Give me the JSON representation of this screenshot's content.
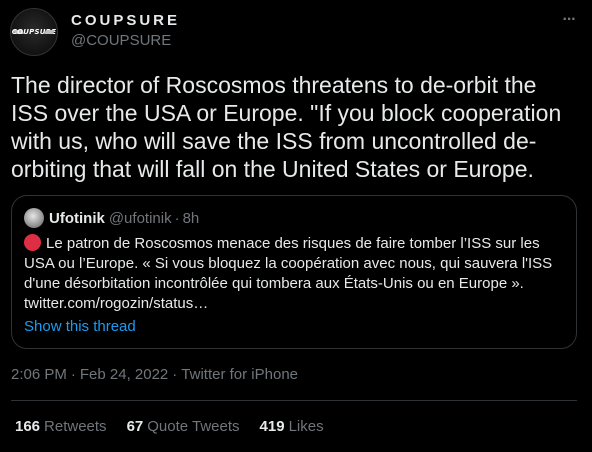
{
  "author": {
    "display_name": "COUPSURE",
    "handle": "@COUPSURE",
    "avatar_text": "COUPSURE"
  },
  "more_icon": "more-horizontal-icon",
  "more_label": "···",
  "tweet": {
    "text": "The director of Roscosmos threatens to de-orbit the ISS over the USA or Europe. \"If you block cooperation with us, who will save the ISS from uncontrolled de-orbiting that will fall on the United States or Europe."
  },
  "quote": {
    "name": "Ufotinik",
    "handle": "@ufotinik",
    "dot": "·",
    "time": "8h",
    "emoji": "red-circle-emoji",
    "text": "Le patron de Roscosmos menace des risques de faire tomber l’ISS sur les USA ou l’Europe. « Si vous bloquez la coopération avec nous, qui sauvera l'ISS d'une désorbitation incontrôlée qui tombera aux États-Unis ou en Europe ». twitter.com/rogozin/status…",
    "show_thread": "Show this thread"
  },
  "meta": {
    "time": "2:06 PM",
    "sep": "·",
    "date": "Feb 24, 2022",
    "source": "Twitter for iPhone"
  },
  "stats": {
    "retweets_count": "166",
    "retweets_label": "Retweets",
    "quotes_count": "67",
    "quotes_label": "Quote Tweets",
    "likes_count": "419",
    "likes_label": "Likes"
  },
  "colors": {
    "background": "#000000",
    "text": "#e7e9ea",
    "secondary": "#71767b",
    "link": "#1d9bf0",
    "border": "#2f3336",
    "red_circle": "#dd2e44"
  }
}
